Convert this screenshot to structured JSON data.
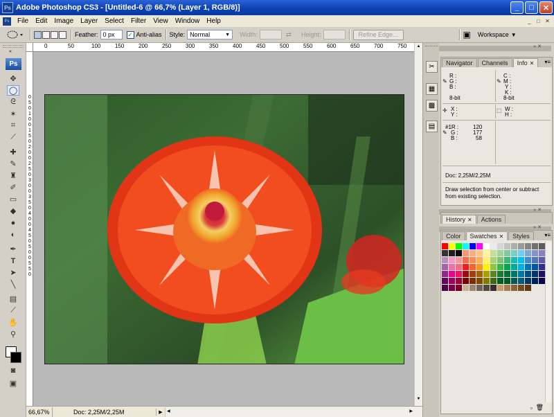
{
  "window": {
    "title": "Adobe Photoshop CS3 - [Untitled-6 @ 66,7% (Layer 1, RGB/8)]",
    "app_icon": "Ps",
    "min": "_",
    "max": "□",
    "close": "✕"
  },
  "menu": {
    "items": [
      "File",
      "Edit",
      "Image",
      "Layer",
      "Select",
      "Filter",
      "View",
      "Window",
      "Help"
    ],
    "doc_min": "_",
    "doc_restore": "□",
    "doc_close": "✕"
  },
  "options": {
    "feather_label": "Feather:",
    "feather_value": "0 px",
    "antialias_label": "Anti-alias",
    "antialias_checked": true,
    "style_label": "Style:",
    "style_value": "Normal",
    "width_label": "Width:",
    "height_label": "Height:",
    "refine_edge": "Refine Edge...",
    "workspace": "Workspace"
  },
  "rulers": {
    "top": [
      "0",
      "50",
      "100",
      "150",
      "200",
      "250",
      "300",
      "350",
      "400",
      "450",
      "500",
      "550",
      "600",
      "650",
      "700",
      "750"
    ],
    "left": [
      "0",
      "5",
      "0",
      "1",
      "0",
      "0",
      "1",
      "5",
      "0",
      "2",
      "0",
      "0",
      "2",
      "5",
      "0",
      "3",
      "0",
      "0",
      "3",
      "5",
      "0",
      "4",
      "0",
      "0",
      "4",
      "5",
      "0",
      "5",
      "0",
      "0",
      "5",
      "5",
      "0"
    ]
  },
  "status": {
    "zoom": "66,67%",
    "doc": "Doc: 2,25M/2,25M"
  },
  "navigator_panel": {
    "tabs": [
      "Navigator",
      "Channels",
      "Info"
    ],
    "active": "Info"
  },
  "info": {
    "r": "R :",
    "g": "G :",
    "b": "B :",
    "c": "C :",
    "m": "M :",
    "y": "Y :",
    "k": "K :",
    "bit1": "8-bit",
    "bit2": "8-bit",
    "x": "X :",
    "yy": "Y :",
    "w": "W :",
    "h": "H :",
    "s1r_label": "#1R :",
    "s1r": "120",
    "s1g_label": "G :",
    "s1g": "177",
    "s1b_label": "B :",
    "s1b": "58",
    "doc": "Doc: 2,25M/2,25M",
    "hint": "Draw selection from center or subtract from existing selection."
  },
  "history_panel": {
    "tabs": [
      "History",
      "Actions"
    ],
    "active": "History"
  },
  "swatches_panel": {
    "tabs": [
      "Color",
      "Swatches",
      "Styles"
    ],
    "active": "Swatches"
  },
  "swatch_colors": [
    "#ff0000",
    "#ffff00",
    "#00ff00",
    "#00ffff",
    "#0000ff",
    "#ff00ff",
    "#ffffff",
    "#ebebeb",
    "#d6d6d6",
    "#c2c2c2",
    "#adadad",
    "#999999",
    "#858585",
    "#707070",
    "#5c5c5c",
    "#474747",
    "#333333",
    "#1f1f1f",
    "#0a0a0a",
    "#f7977a",
    "#f9ad81",
    "#fdc68a",
    "#fff79a",
    "#c4df9b",
    "#a3d39c",
    "#82ca9d",
    "#7bcdc8",
    "#6ecff6",
    "#7ea7d8",
    "#8493ca",
    "#8882be",
    "#a187be",
    "#bc8dbf",
    "#f49ac2",
    "#f6989d",
    "#f26c4f",
    "#f68e56",
    "#fbaf5d",
    "#fff467",
    "#acd372",
    "#7cc576",
    "#3bb878",
    "#1abbb4",
    "#00bff3",
    "#438ccb",
    "#5574b9",
    "#605ca8",
    "#855fa8",
    "#a763a8",
    "#f06eaa",
    "#f26d7d",
    "#ed1c24",
    "#f26522",
    "#f7941d",
    "#fff200",
    "#8dc73f",
    "#39b54a",
    "#00a651",
    "#00a99d",
    "#00aeef",
    "#0072bc",
    "#0054a6",
    "#2e3192",
    "#662d91",
    "#92278f",
    "#ec008c",
    "#ed145b",
    "#9e0b0f",
    "#a0410d",
    "#a36209",
    "#aba000",
    "#598527",
    "#1a7b30",
    "#007236",
    "#00746b",
    "#0076a3",
    "#004b80",
    "#003471",
    "#1b1464",
    "#440e62",
    "#630460",
    "#9e005d",
    "#9e0039",
    "#790000",
    "#7b2e00",
    "#7d4900",
    "#827b00",
    "#406618",
    "#005e20",
    "#005826",
    "#005952",
    "#005b7f",
    "#003663",
    "#002157",
    "#0d004c",
    "#32004b",
    "#4b0049",
    "#7b0046",
    "#7a0026",
    "#c7b299",
    "#998675",
    "#736357",
    "#534741",
    "#37302a",
    "#c69c6d",
    "#a67c52",
    "#8c6239",
    "#754c24",
    "#603913"
  ]
}
